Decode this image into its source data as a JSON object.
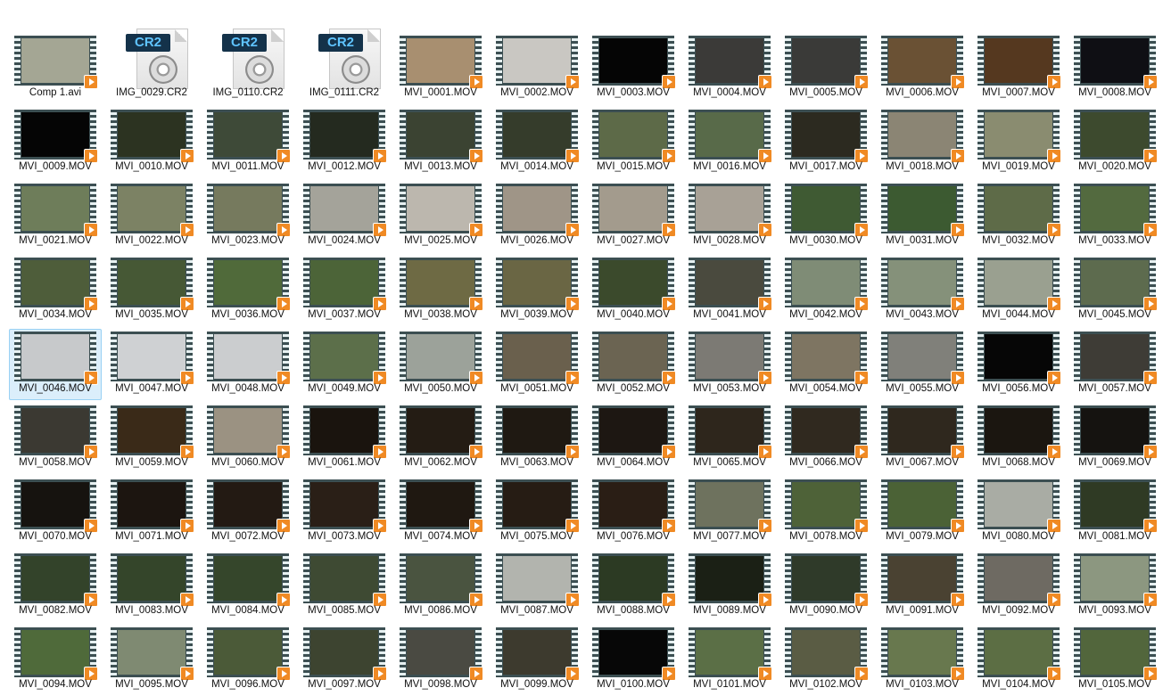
{
  "files": [
    {
      "name": "Comp 1.avi",
      "kind": "video",
      "thumb": "#a4a694"
    },
    {
      "name": "IMG_0029.CR2",
      "kind": "cr2",
      "icon_text": "CR2"
    },
    {
      "name": "IMG_0110.CR2",
      "kind": "cr2",
      "icon_text": "CR2"
    },
    {
      "name": "IMG_0111.CR2",
      "kind": "cr2",
      "icon_text": "CR2"
    },
    {
      "name": "MVI_0001.MOV",
      "kind": "video",
      "thumb": "#a88f70"
    },
    {
      "name": "MVI_0002.MOV",
      "kind": "video",
      "thumb": "#c9c7c2"
    },
    {
      "name": "MVI_0003.MOV",
      "kind": "video",
      "thumb": "#050505"
    },
    {
      "name": "MVI_0004.MOV",
      "kind": "video",
      "thumb": "#3b3a38"
    },
    {
      "name": "MVI_0005.MOV",
      "kind": "video",
      "thumb": "#3a3a38"
    },
    {
      "name": "MVI_0006.MOV",
      "kind": "video",
      "thumb": "#6a5134"
    },
    {
      "name": "MVI_0007.MOV",
      "kind": "video",
      "thumb": "#55381f"
    },
    {
      "name": "MVI_0008.MOV",
      "kind": "video",
      "thumb": "#0f0f14"
    },
    {
      "name": "MVI_0009.MOV",
      "kind": "video",
      "thumb": "#050505"
    },
    {
      "name": "MVI_0010.MOV",
      "kind": "video",
      "thumb": "#2c3321"
    },
    {
      "name": "MVI_0011.MOV",
      "kind": "video",
      "thumb": "#3e4a38"
    },
    {
      "name": "MVI_0012.MOV",
      "kind": "video",
      "thumb": "#242a1f"
    },
    {
      "name": "MVI_0013.MOV",
      "kind": "video",
      "thumb": "#3b4332"
    },
    {
      "name": "MVI_0014.MOV",
      "kind": "video",
      "thumb": "#353c2b"
    },
    {
      "name": "MVI_0015.MOV",
      "kind": "video",
      "thumb": "#5d6a48"
    },
    {
      "name": "MVI_0016.MOV",
      "kind": "video",
      "thumb": "#586a49"
    },
    {
      "name": "MVI_0017.MOV",
      "kind": "video",
      "thumb": "#2c2a20"
    },
    {
      "name": "MVI_0018.MOV",
      "kind": "video",
      "thumb": "#8b8574"
    },
    {
      "name": "MVI_0019.MOV",
      "kind": "video",
      "thumb": "#8a8c70"
    },
    {
      "name": "MVI_0020.MOV",
      "kind": "video",
      "thumb": "#3d4a2e"
    },
    {
      "name": "MVI_0021.MOV",
      "kind": "video",
      "thumb": "#6e7d5a"
    },
    {
      "name": "MVI_0022.MOV",
      "kind": "video",
      "thumb": "#7c8264"
    },
    {
      "name": "MVI_0023.MOV",
      "kind": "video",
      "thumb": "#767a5e"
    },
    {
      "name": "MVI_0024.MOV",
      "kind": "video",
      "thumb": "#a4a39a"
    },
    {
      "name": "MVI_0025.MOV",
      "kind": "video",
      "thumb": "#bcb7ae"
    },
    {
      "name": "MVI_0026.MOV",
      "kind": "video",
      "thumb": "#9f9587"
    },
    {
      "name": "MVI_0027.MOV",
      "kind": "video",
      "thumb": "#a39b8d"
    },
    {
      "name": "MVI_0028.MOV",
      "kind": "video",
      "thumb": "#a8a196"
    },
    {
      "name": "MVI_0030.MOV",
      "kind": "video",
      "thumb": "#3f5a33"
    },
    {
      "name": "MVI_0031.MOV",
      "kind": "video",
      "thumb": "#3c5a31"
    },
    {
      "name": "MVI_0032.MOV",
      "kind": "video",
      "thumb": "#5e6b48"
    },
    {
      "name": "MVI_0033.MOV",
      "kind": "video",
      "thumb": "#536a3f"
    },
    {
      "name": "MVI_0034.MOV",
      "kind": "video",
      "thumb": "#4e5d3a"
    },
    {
      "name": "MVI_0035.MOV",
      "kind": "video",
      "thumb": "#465835"
    },
    {
      "name": "MVI_0036.MOV",
      "kind": "video",
      "thumb": "#506a3a"
    },
    {
      "name": "MVI_0037.MOV",
      "kind": "video",
      "thumb": "#4c6438"
    },
    {
      "name": "MVI_0038.MOV",
      "kind": "video",
      "thumb": "#6e6a44"
    },
    {
      "name": "MVI_0039.MOV",
      "kind": "video",
      "thumb": "#6a6644"
    },
    {
      "name": "MVI_0040.MOV",
      "kind": "video",
      "thumb": "#3b4a2c"
    },
    {
      "name": "MVI_0041.MOV",
      "kind": "video",
      "thumb": "#4a4a3e"
    },
    {
      "name": "MVI_0042.MOV",
      "kind": "video",
      "thumb": "#7f8c76"
    },
    {
      "name": "MVI_0043.MOV",
      "kind": "video",
      "thumb": "#85917a"
    },
    {
      "name": "MVI_0044.MOV",
      "kind": "video",
      "thumb": "#9aa090"
    },
    {
      "name": "MVI_0045.MOV",
      "kind": "video",
      "thumb": "#5d6b4e"
    },
    {
      "name": "MVI_0046.MOV",
      "kind": "video",
      "thumb": "#c7c9cb",
      "selected": true
    },
    {
      "name": "MVI_0047.MOV",
      "kind": "video",
      "thumb": "#cfd1d3"
    },
    {
      "name": "MVI_0048.MOV",
      "kind": "video",
      "thumb": "#cbcdcf"
    },
    {
      "name": "MVI_0049.MOV",
      "kind": "video",
      "thumb": "#5c6f4a"
    },
    {
      "name": "MVI_0050.MOV",
      "kind": "video",
      "thumb": "#9ca29a"
    },
    {
      "name": "MVI_0051.MOV",
      "kind": "video",
      "thumb": "#6a604d"
    },
    {
      "name": "MVI_0052.MOV",
      "kind": "video",
      "thumb": "#6b6452"
    },
    {
      "name": "MVI_0053.MOV",
      "kind": "video",
      "thumb": "#7c7a74"
    },
    {
      "name": "MVI_0054.MOV",
      "kind": "video",
      "thumb": "#7e7562"
    },
    {
      "name": "MVI_0055.MOV",
      "kind": "video",
      "thumb": "#80807a"
    },
    {
      "name": "MVI_0056.MOV",
      "kind": "video",
      "thumb": "#060606"
    },
    {
      "name": "MVI_0057.MOV",
      "kind": "video",
      "thumb": "#3e3c36"
    },
    {
      "name": "MVI_0058.MOV",
      "kind": "video",
      "thumb": "#3b3932"
    },
    {
      "name": "MVI_0059.MOV",
      "kind": "video",
      "thumb": "#3a2a18"
    },
    {
      "name": "MVI_0060.MOV",
      "kind": "video",
      "thumb": "#9b9282"
    },
    {
      "name": "MVI_0061.MOV",
      "kind": "video",
      "thumb": "#1a140e"
    },
    {
      "name": "MVI_0062.MOV",
      "kind": "video",
      "thumb": "#241c14"
    },
    {
      "name": "MVI_0063.MOV",
      "kind": "video",
      "thumb": "#1f1912"
    },
    {
      "name": "MVI_0064.MOV",
      "kind": "video",
      "thumb": "#1d1712"
    },
    {
      "name": "MVI_0065.MOV",
      "kind": "video",
      "thumb": "#2e261c"
    },
    {
      "name": "MVI_0066.MOV",
      "kind": "video",
      "thumb": "#30291f"
    },
    {
      "name": "MVI_0067.MOV",
      "kind": "video",
      "thumb": "#2f281e"
    },
    {
      "name": "MVI_0068.MOV",
      "kind": "video",
      "thumb": "#1b1610"
    },
    {
      "name": "MVI_0069.MOV",
      "kind": "video",
      "thumb": "#151310"
    },
    {
      "name": "MVI_0070.MOV",
      "kind": "video",
      "thumb": "#16130f"
    },
    {
      "name": "MVI_0071.MOV",
      "kind": "video",
      "thumb": "#1c1510"
    },
    {
      "name": "MVI_0072.MOV",
      "kind": "video",
      "thumb": "#231a13"
    },
    {
      "name": "MVI_0073.MOV",
      "kind": "video",
      "thumb": "#2a1f17"
    },
    {
      "name": "MVI_0074.MOV",
      "kind": "video",
      "thumb": "#1f1811"
    },
    {
      "name": "MVI_0075.MOV",
      "kind": "video",
      "thumb": "#261c14"
    },
    {
      "name": "MVI_0076.MOV",
      "kind": "video",
      "thumb": "#2a1e15"
    },
    {
      "name": "MVI_0077.MOV",
      "kind": "video",
      "thumb": "#6e725e"
    },
    {
      "name": "MVI_0078.MOV",
      "kind": "video",
      "thumb": "#4e6238"
    },
    {
      "name": "MVI_0079.MOV",
      "kind": "video",
      "thumb": "#4b6236"
    },
    {
      "name": "MVI_0080.MOV",
      "kind": "video",
      "thumb": "#a9aca4"
    },
    {
      "name": "MVI_0081.MOV",
      "kind": "video",
      "thumb": "#2f3a24"
    },
    {
      "name": "MVI_0082.MOV",
      "kind": "video",
      "thumb": "#33432a"
    },
    {
      "name": "MVI_0083.MOV",
      "kind": "video",
      "thumb": "#34452a"
    },
    {
      "name": "MVI_0084.MOV",
      "kind": "video",
      "thumb": "#35462b"
    },
    {
      "name": "MVI_0085.MOV",
      "kind": "video",
      "thumb": "#3e4a33"
    },
    {
      "name": "MVI_0086.MOV",
      "kind": "video",
      "thumb": "#4a5440"
    },
    {
      "name": "MVI_0087.MOV",
      "kind": "video",
      "thumb": "#b2b4ae"
    },
    {
      "name": "MVI_0088.MOV",
      "kind": "video",
      "thumb": "#2c3a23"
    },
    {
      "name": "MVI_0089.MOV",
      "kind": "video",
      "thumb": "#1b2015"
    },
    {
      "name": "MVI_0090.MOV",
      "kind": "video",
      "thumb": "#2f3a29"
    },
    {
      "name": "MVI_0091.MOV",
      "kind": "video",
      "thumb": "#4a4232"
    },
    {
      "name": "MVI_0092.MOV",
      "kind": "video",
      "thumb": "#6e6a62"
    },
    {
      "name": "MVI_0093.MOV",
      "kind": "video",
      "thumb": "#8c9780"
    },
    {
      "name": "MVI_0094.MOV",
      "kind": "video",
      "thumb": "#4f6a3a"
    },
    {
      "name": "MVI_0095.MOV",
      "kind": "video",
      "thumb": "#7f8a72"
    },
    {
      "name": "MVI_0096.MOV",
      "kind": "video",
      "thumb": "#4b5a38"
    },
    {
      "name": "MVI_0097.MOV",
      "kind": "video",
      "thumb": "#3d4430"
    },
    {
      "name": "MVI_0098.MOV",
      "kind": "video",
      "thumb": "#4a4a42"
    },
    {
      "name": "MVI_0099.MOV",
      "kind": "video",
      "thumb": "#3d3a2e"
    },
    {
      "name": "MVI_0100.MOV",
      "kind": "video",
      "thumb": "#070707"
    },
    {
      "name": "MVI_0101.MOV",
      "kind": "video",
      "thumb": "#5b6f46"
    },
    {
      "name": "MVI_0102.MOV",
      "kind": "video",
      "thumb": "#5a5c44"
    },
    {
      "name": "MVI_0103.MOV",
      "kind": "video",
      "thumb": "#68784e"
    },
    {
      "name": "MVI_0104.MOV",
      "kind": "video",
      "thumb": "#5c6e44"
    },
    {
      "name": "MVI_0105.MOV",
      "kind": "video",
      "thumb": "#52663c"
    }
  ]
}
